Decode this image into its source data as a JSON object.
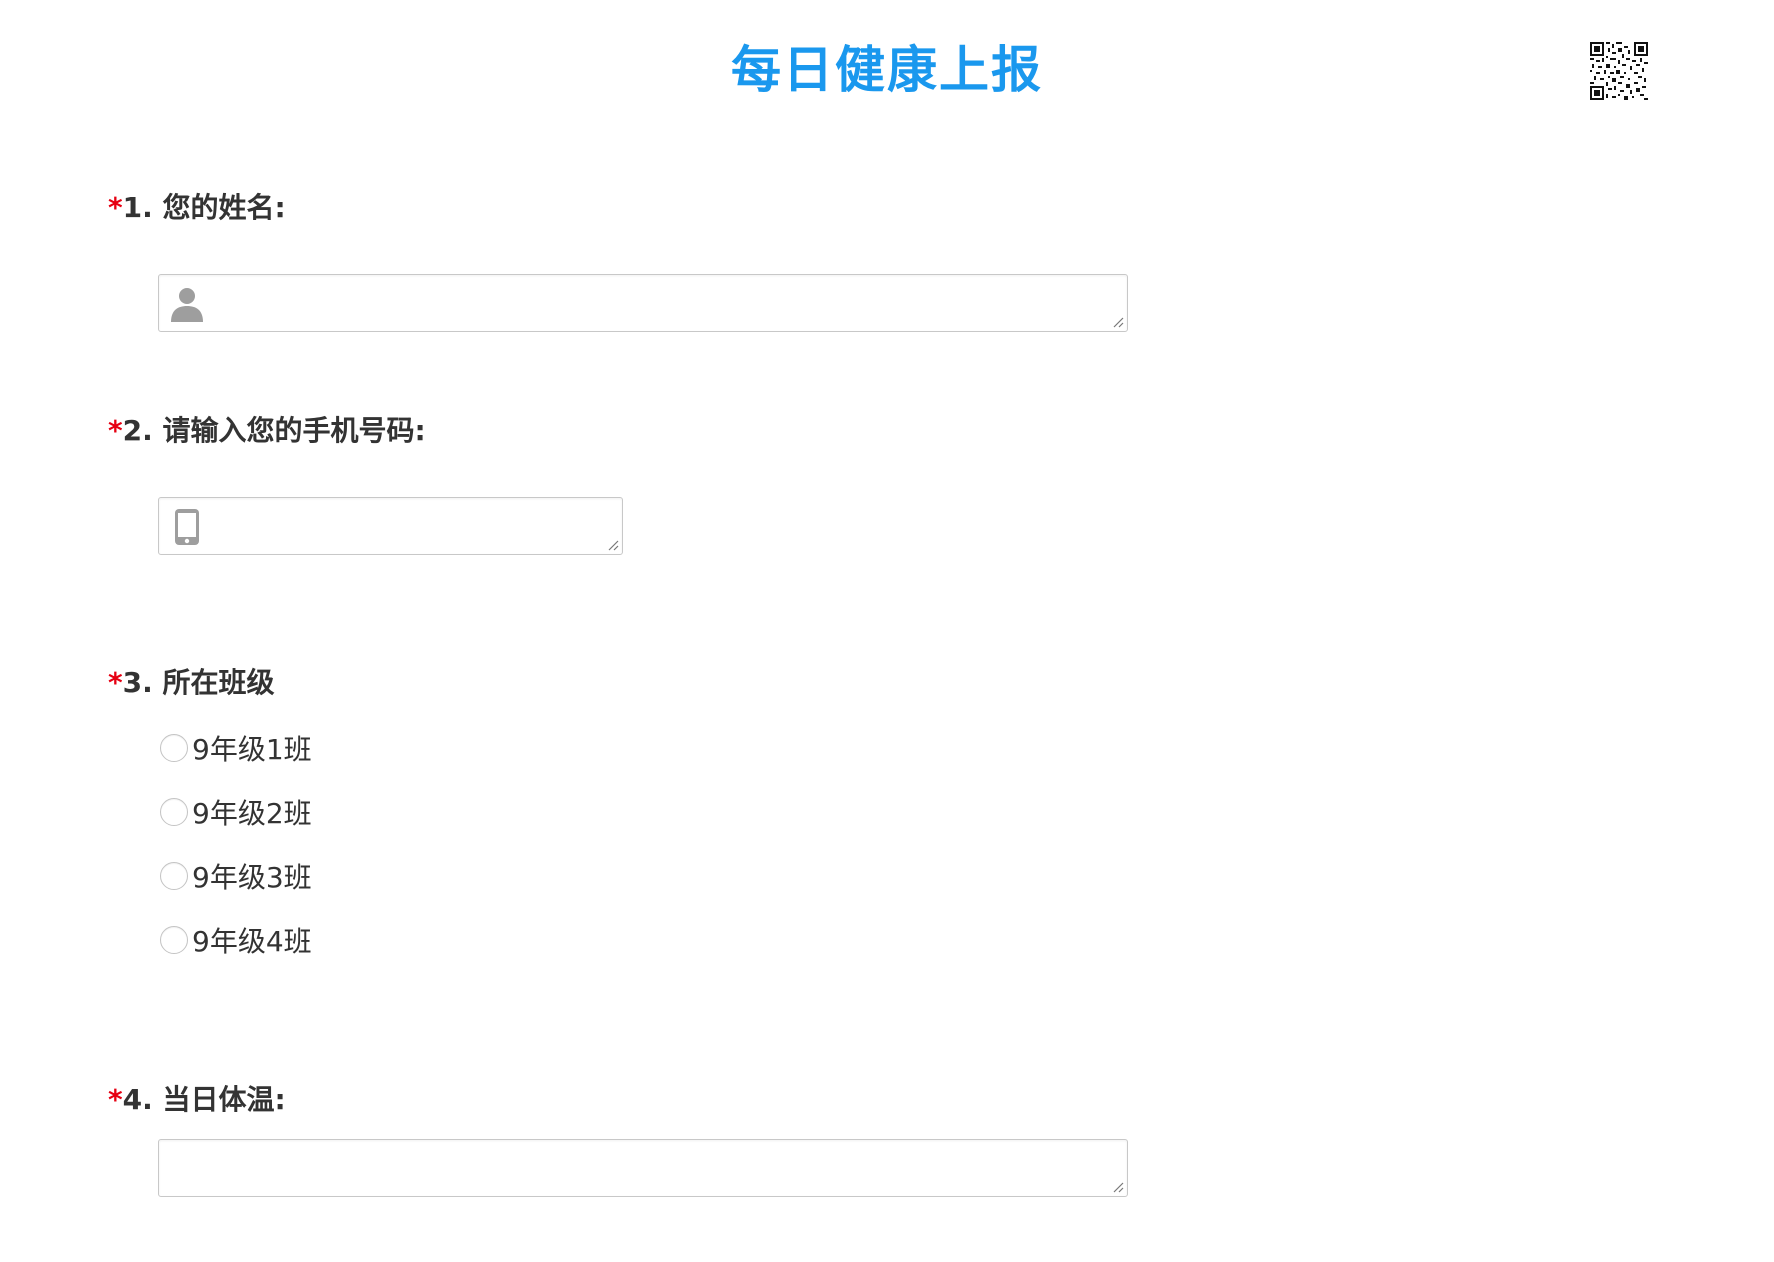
{
  "form": {
    "title": "每日健康上报"
  },
  "questions": [
    {
      "required_mark": "*",
      "number": "1.",
      "label": "您的姓名:",
      "field_icon": "user-icon"
    },
    {
      "required_mark": "*",
      "number": "2.",
      "label": "请输入您的手机号码:",
      "field_icon": "phone-icon"
    },
    {
      "required_mark": "*",
      "number": "3.",
      "label": "所在班级",
      "options": [
        "9年级1班",
        "9年级2班",
        "9年级3班",
        "9年级4班"
      ]
    },
    {
      "required_mark": "*",
      "number": "4.",
      "label": "当日体温:"
    }
  ],
  "colors": {
    "title": "#1a98ee",
    "required": "#e60012",
    "text": "#333333",
    "border": "#c8c8c8"
  }
}
